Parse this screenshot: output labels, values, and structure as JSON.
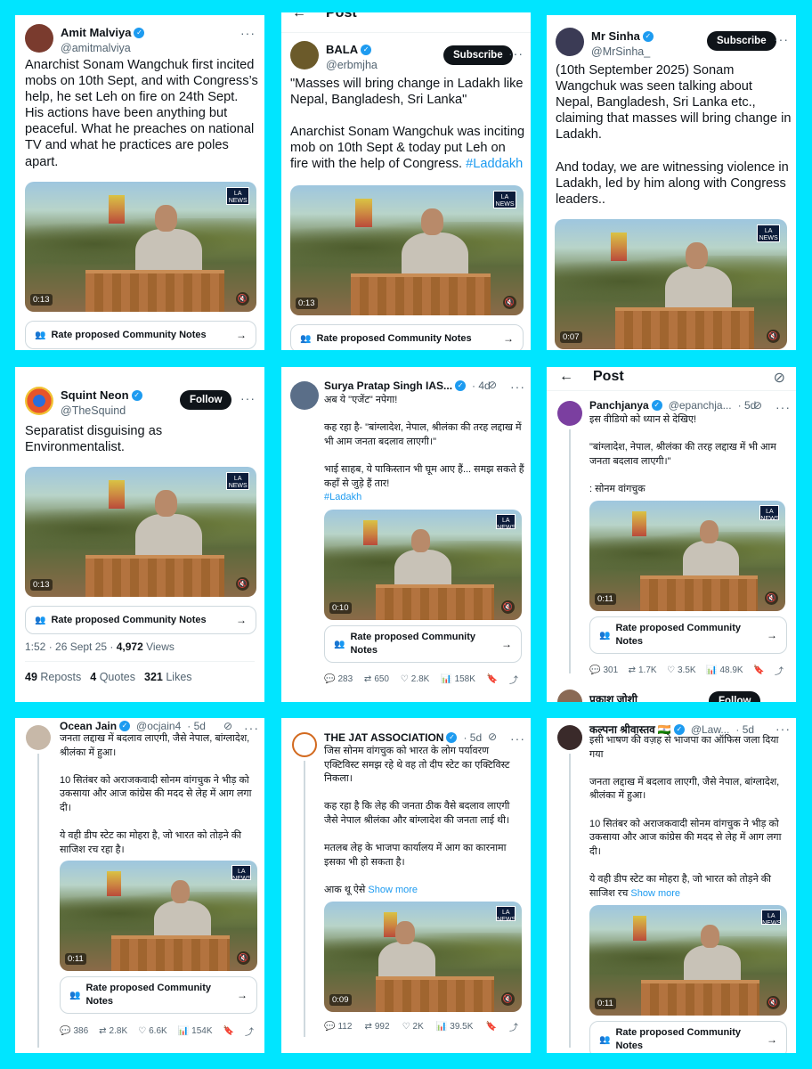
{
  "common": {
    "notes_label": "Rate proposed Community Notes",
    "notes_label_wrapped": "Rate proposed Community\nNotes",
    "post_title": "Post",
    "logo_text": "LA\nNEWS",
    "verified_glyph": "✓",
    "more_glyph": "···"
  },
  "cards": {
    "c1": {
      "name": "Amit Malviya",
      "handle": "@amitmalviya",
      "text": "Anarchist Sonam Wangchuk first incited mobs on 10th Sept, and with Congress’s help, he set Leh on fire on 24th Sept. His actions have been anything but peaceful. What he preaches on national TV and what he practices are poles apart.",
      "duration": "0:13"
    },
    "c2": {
      "name": "BALA",
      "handle": "@erbmjha",
      "button": "Subscribe",
      "text": "\"Masses will bring change in Ladakh like Nepal, Bangladesh, Sri Lanka\"\n\nAnarchist Sonam Wangchuk was inciting mob on 10th Sept & today put Leh on fire with the help of Congress. ",
      "hashtag": "#Laddakh",
      "duration": "0:13"
    },
    "c3": {
      "name": "Mr Sinha",
      "handle": "@MrSinha_",
      "button": "Subscribe",
      "text": "(10th September 2025) Sonam Wangchuk was seen talking about Nepal, Bangladesh, Sri Lanka etc., claiming that masses will bring change in Ladakh.\n\nAnd today, we are witnessing violence in Ladakh, led by him along with Congress leaders..",
      "duration": "0:07"
    },
    "c4": {
      "name": "Squint Neon",
      "handle": "@TheSquind",
      "button": "Follow",
      "text": "Separatist disguising as Environmentalist.",
      "duration": "0:13",
      "time": "1:52 · 26 Sept 25 · ",
      "views_count": "4,972",
      "views_label": " Views",
      "reposts_count": "49",
      "reposts_label": "Reposts",
      "quotes_count": "4",
      "quotes_label": "Quotes",
      "likes_count": "321",
      "likes_label": "Likes"
    },
    "c5": {
      "name": "Surya Pratap Singh IAS...",
      "age": "· 4d",
      "text": "अब ये \"एजेंट\" नपेगा!\n\nकह रहा है- \"बांग्लादेश, नेपाल, श्रीलंका की तरह लद्दाख में भी आम जनता बदलाव लाएगी।\"\n\nभाई साहब, ये पाकिस्तान भी घूम आए हैं... समझ सकते हैं कहाँ से जुड़े हैं तार!",
      "hashtag": "#Ladakh",
      "duration": "0:10",
      "replies": "283",
      "reposts": "650",
      "likes": "2.8K",
      "views": "158K"
    },
    "c6": {
      "name": "Panchjanya",
      "handle": "@epanchja...",
      "age": "· 5d",
      "text": "इस वीडियो को ध्यान से देखिए!\n\n\"बांग्लादेश, नेपाल, श्रीलंका की तरह लद्दाख में भी आम जनता बदलाव लाएगी।\"\n\n: सोनम वांगचुक",
      "duration": "0:11",
      "replies": "301",
      "reposts": "1.7K",
      "likes": "3.5K",
      "views": "48.9K",
      "next_name": "प्रकाश जोशी",
      "next_button": "Follow"
    },
    "c7": {
      "name": "Ocean Jain",
      "handle": "@ocjain4",
      "age": "· 5d",
      "text": "जनता लद्दाख में बदलाव लाएगी, जैसे नेपाल, बांग्लादेश, श्रीलंका में हुआ।\n\n10 सितंबर को अराजकवादी सोनम वांगचुक ने भीड़ को उकसाया और आज कांग्रेस की मदद से लेह में आग लगा दी।\n\nये वही डीप स्टेट का मोहरा है, जो भारत को तोड़ने की साजिश रच रहा है।",
      "duration": "0:11",
      "replies": "386",
      "reposts": "2.8K",
      "likes": "6.6K",
      "views": "154K"
    },
    "c8": {
      "name": "THE JAT ASSOCIATION",
      "age": "· 5d",
      "text": "जिस सोनम वांगचुक को भारत के लोग पर्यावरण एक्टिविस्ट समझ रहे थे वह तो दीप स्टेट का एक्टिविस्ट निकला।\n\nकह रहा है कि लेह की जनता ठीक वैसे बदलाव लाएगी जैसे नेपाल श्रीलंका और बांग्लादेश की जनता लाई थी।\n\nमतलब लेह के भाजपा कार्यालय में आग का कारनामा इसका भी हो सकता है।\n\nआक थू ऐसे ",
      "show_more": "Show more",
      "duration": "0:09",
      "replies": "112",
      "reposts": "992",
      "likes": "2K",
      "views": "39.5K"
    },
    "c9": {
      "name": "कल्पना श्रीवास्तव",
      "flag": "🇮🇳",
      "handle": "@Law...",
      "age": "· 5d",
      "text": "इसी भाषण की वज़ह से भाजपा का ऑफिस जला दिया गया\n\nजनता लद्दाख में बदलाव लाएगी, जैसे नेपाल, बांग्लादेश, श्रीलंका में हुआ।\n\n10 सितंबर को अराजकवादी सोनम वांगचुक ने भीड़ को उकसाया और आज कांग्रेस की मदद से लेह में आग लगा दी।\n\nये वही डीप स्टेट का मोहरा है, जो भारत को तोड़ने की साजिश रच ",
      "show_more": "Show more",
      "duration": "0:11"
    }
  },
  "icons": {
    "reply": "💬",
    "repost": "⇄",
    "like": "♡",
    "views": "📊",
    "bookmark": "🔖",
    "share": "⤴",
    "back": "←",
    "grok": "⊘",
    "mute": "🔇",
    "people": "👥",
    "arrow": "→"
  },
  "colors": {
    "background": "#00e5ff",
    "link": "#1d9bf0",
    "verified": "#1d9bf0"
  }
}
